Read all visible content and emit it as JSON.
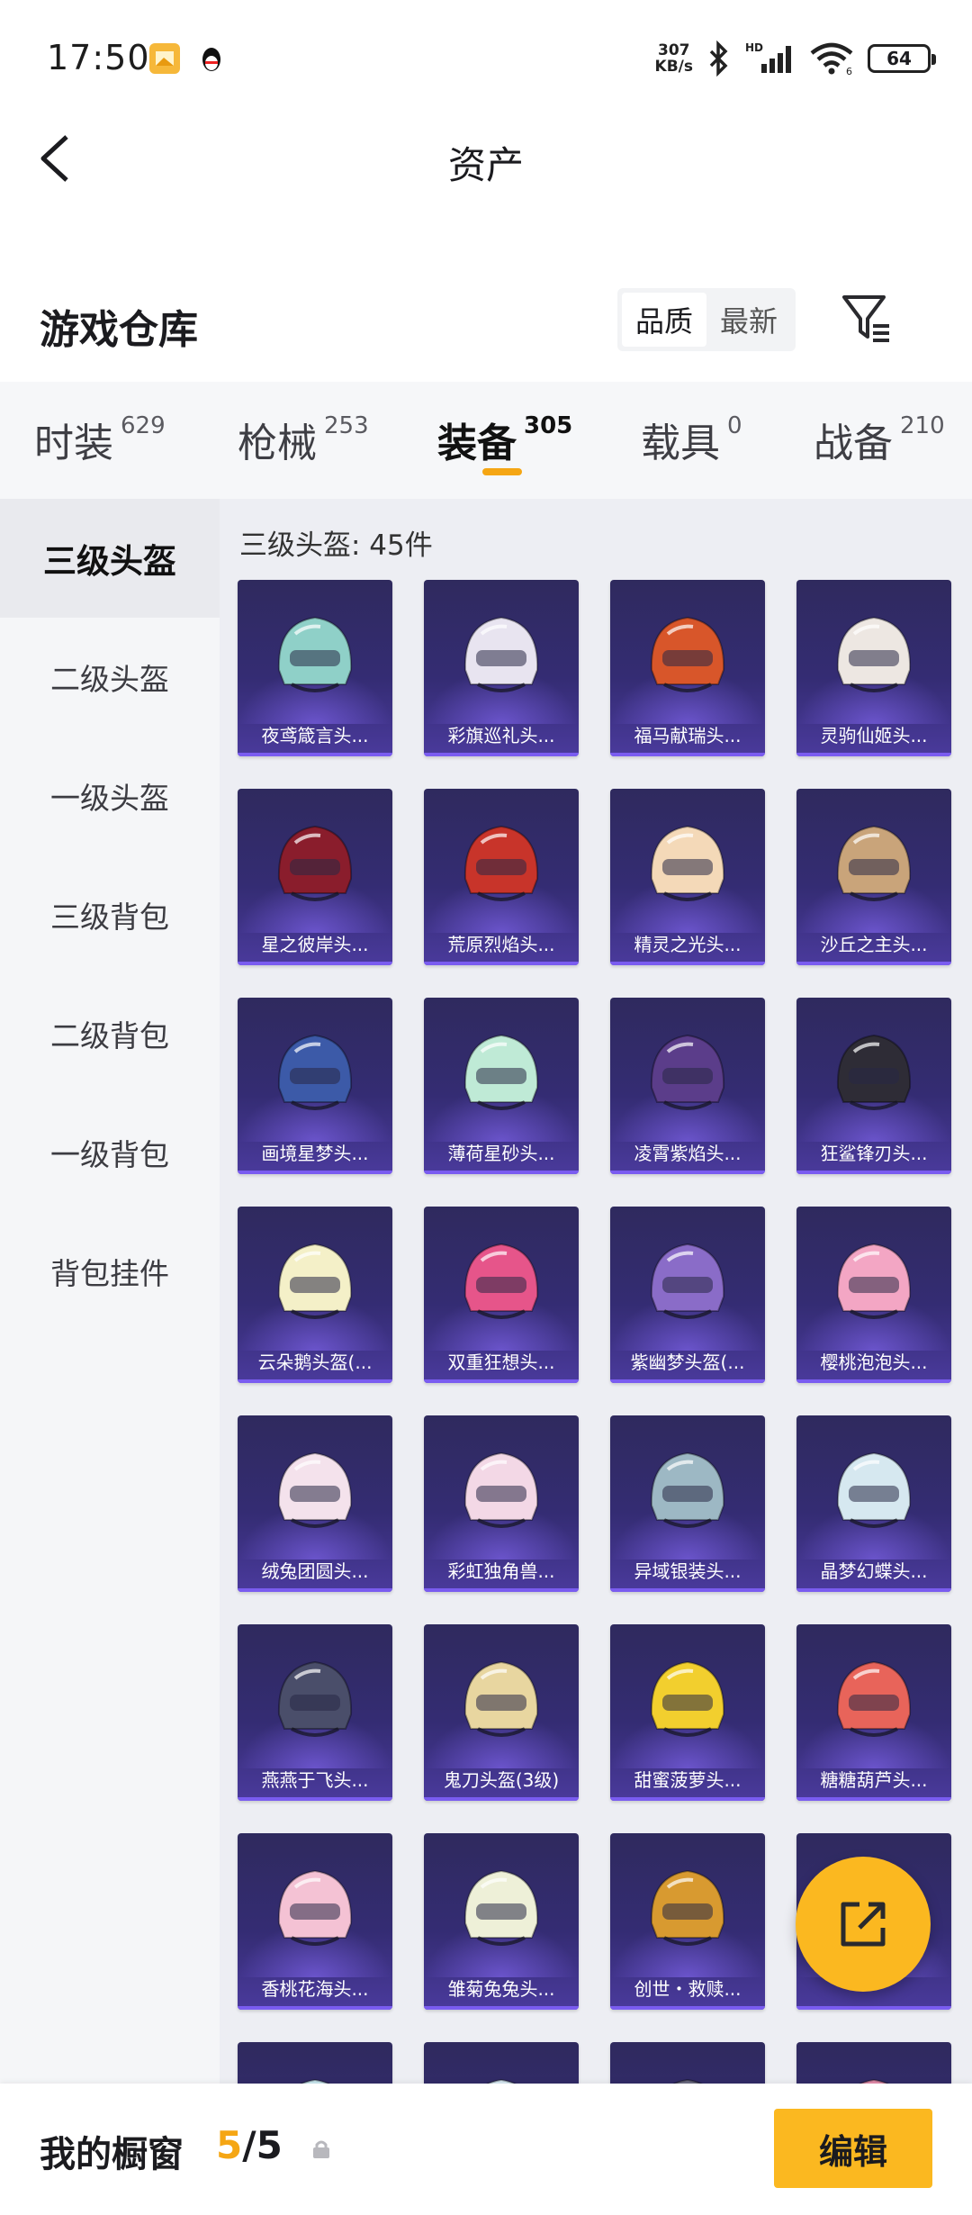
{
  "status_bar": {
    "time": "17:50",
    "net_speed_value": "307",
    "net_speed_unit": "KB/s",
    "battery": "64",
    "icons": [
      "gallery-icon",
      "qq-icon",
      "bluetooth-icon",
      "hd-signal-icon",
      "wifi-icon",
      "battery-icon"
    ]
  },
  "nav": {
    "title": "资产"
  },
  "warehouse": {
    "title": "游戏仓库",
    "sort_options": [
      "品质",
      "最新"
    ],
    "active_sort": "品质"
  },
  "tabs": [
    {
      "label": "时装",
      "count": "629"
    },
    {
      "label": "枪械",
      "count": "253"
    },
    {
      "label": "装备",
      "count": "305",
      "active": true
    },
    {
      "label": "载具",
      "count": "0"
    },
    {
      "label": "战备",
      "count": "210"
    }
  ],
  "sidebar": {
    "items": [
      "三级头盔",
      "二级头盔",
      "一级头盔",
      "三级背包",
      "二级背包",
      "一级背包",
      "背包挂件"
    ],
    "active": "三级头盔"
  },
  "content": {
    "section_title": "三级头盔: 45件",
    "items": [
      {
        "name": "夜鸢箴言头...",
        "color": "#8fd0c8"
      },
      {
        "name": "彩旗巡礼头...",
        "color": "#e8e4f0"
      },
      {
        "name": "福马献瑞头...",
        "color": "#d8562a"
      },
      {
        "name": "灵驹仙姬头...",
        "color": "#ede7e2"
      },
      {
        "name": "星之彼岸头...",
        "color": "#8a1d2c"
      },
      {
        "name": "荒原烈焰头...",
        "color": "#c8342a"
      },
      {
        "name": "精灵之光头...",
        "color": "#f4d9b8"
      },
      {
        "name": "沙丘之主头...",
        "color": "#c9a47a"
      },
      {
        "name": "画境星梦头...",
        "color": "#3c5aa8"
      },
      {
        "name": "薄荷星砂头...",
        "color": "#bfead6"
      },
      {
        "name": "凌霄紫焰头...",
        "color": "#5b3d8a"
      },
      {
        "name": "狂鲨锋刃头...",
        "color": "#2e2c36"
      },
      {
        "name": "云朵鹅头盔(...",
        "color": "#f4f0c8"
      },
      {
        "name": "双重狂想头...",
        "color": "#e6558a"
      },
      {
        "name": "紫幽梦头盔(...",
        "color": "#8a6cc8"
      },
      {
        "name": "樱桃泡泡头...",
        "color": "#f3a6c4"
      },
      {
        "name": "绒兔团圆头...",
        "color": "#f4e2ec"
      },
      {
        "name": "彩虹独角兽...",
        "color": "#f3d8e6"
      },
      {
        "name": "异域银装头...",
        "color": "#9db8c4"
      },
      {
        "name": "晶梦幻蝶头...",
        "color": "#d6e8f0"
      },
      {
        "name": "燕燕于飞头...",
        "color": "#4a4e6a"
      },
      {
        "name": "鬼刀头盔(3级)",
        "color": "#e8d6a0"
      },
      {
        "name": "甜蜜菠萝头...",
        "color": "#f2cf2e"
      },
      {
        "name": "糖糖葫芦头...",
        "color": "#e8645a"
      },
      {
        "name": "香桃花海头...",
        "color": "#f4c2d4"
      },
      {
        "name": "雏菊兔兔头...",
        "color": "#eef0d8"
      },
      {
        "name": "创世・救赎...",
        "color": "#d89a30"
      },
      {
        "name": "",
        "color": "#e07aa6"
      },
      {
        "name": "",
        "color": "#c8e6ee"
      },
      {
        "name": "",
        "color": "#d6e8f2"
      },
      {
        "name": "",
        "color": "#6a6a80"
      },
      {
        "name": "",
        "color": "#e08aa8"
      }
    ]
  },
  "bottom_bar": {
    "label": "我的橱窗",
    "current": "5",
    "total": "/5",
    "edit_label": "编辑"
  },
  "colors": {
    "accent": "#f5a614",
    "button_yellow": "#fbb820",
    "card_purple": "#342c73"
  }
}
